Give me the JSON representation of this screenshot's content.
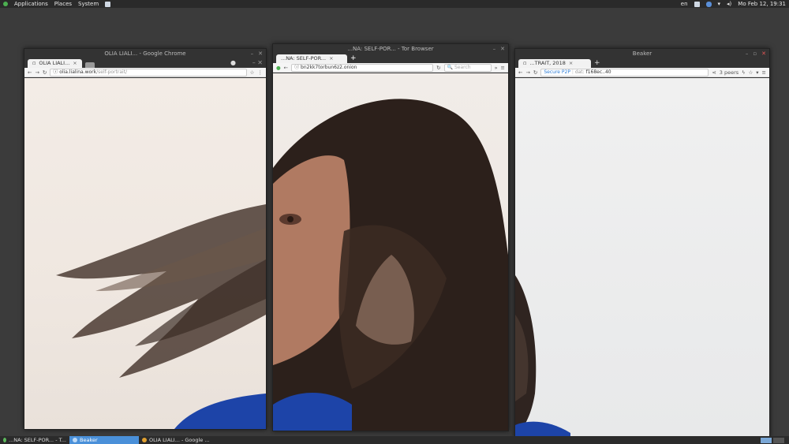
{
  "panel": {
    "menus": [
      "Applications",
      "Places",
      "System"
    ],
    "keyboard": "en",
    "clock": "Mo Feb 12, 19:31"
  },
  "chrome": {
    "title": "OLIA LIALI... - Google Chrome",
    "tab_label": "OLIA LIALI...",
    "tab_close": "×",
    "url_host": "olia.lialina.work",
    "url_path": "/self-portrait/"
  },
  "tor": {
    "title": "...NA: SELF-POR... - Tor Browser",
    "tab_label": "...NA: SELF-POR...",
    "tab_close": "×",
    "new_tab": "+",
    "url": "bn2kk7torbun6z2.onion",
    "search_placeholder": "Search"
  },
  "beaker": {
    "title": "Beaker",
    "tab_label": "...TRAIT, 2018",
    "tab_close": "×",
    "new_tab": "+",
    "secure_label": "Secure P2P",
    "url_scheme": "dat:",
    "url_rest": "f168ec..40",
    "peers": "3 peers"
  },
  "taskbar": {
    "items": [
      {
        "label": "...NA: SELF-POR... - T...",
        "active": false,
        "color": "#5cb85c"
      },
      {
        "label": "Beaker",
        "active": true,
        "color": "#4a90d9"
      },
      {
        "label": "OLIA LIALI... - Google ...",
        "active": false,
        "color": "#e0a030"
      }
    ]
  },
  "icons": {
    "back": "←",
    "forward": "→",
    "reload": "↻",
    "star": "☆",
    "menu": "≡",
    "more": "⋮",
    "share": "⋖"
  }
}
